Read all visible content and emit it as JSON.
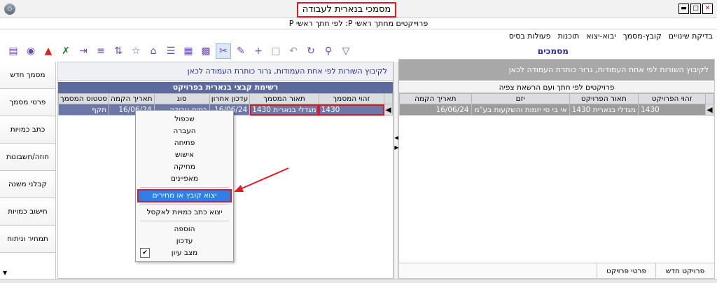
{
  "window": {
    "title": "מסמכי בנארית לעבודה",
    "subtitle": "פרוייקטים מחתך ראשי P: לפי חתך ראשי P"
  },
  "menu": [
    "פעולות בסיס",
    "תוכנות",
    "יבוא-יצוא",
    "קובץ-מסמך",
    "בדיקת שינויים"
  ],
  "section_title": "מסמכים",
  "toolbar_icons": [
    "archive-icon",
    "view-icon",
    "pdf-icon",
    "excel-icon",
    "indent-icon",
    "list-icon",
    "sort-icon",
    "star-icon",
    "bookmark-icon",
    "align-icon",
    "table-icon",
    "qr-icon",
    "cut-icon",
    "edit-icon",
    "plus-icon",
    "save-icon",
    "undo-icon",
    "refresh-icon",
    "search-icon",
    "filter-icon"
  ],
  "left_nav": [
    "מסמך חדש",
    "פרטי מסמך",
    "כתב כמויות",
    "חוזה/חשבונות",
    "קבלני משנה",
    "חישוב כמויות",
    "תמחיר וניתוח"
  ],
  "middle": {
    "grouping_hint": "לקיבוץ השורות לפי אחת העמודות, גרור כותרת העמודה לכאן",
    "grid_title": "רשימת קבצי בנארית בפרויקט",
    "columns": [
      "זהוי המסמך",
      "תאור המסמך",
      "עדכון אחרון",
      "סוג",
      "תאריך הקמה",
      "סטטוס המסמך"
    ],
    "rows": [
      [
        "1430",
        "מגדלי בנארית 1430",
        "16/06/24",
        "בסיס עבודה",
        "16/06/24",
        "תקף"
      ]
    ]
  },
  "right": {
    "grouping_hint": "לקיבוץ השורות לפי אחת העמודות, גרור כותרת העמודה לכאן",
    "grid_title": "פרויקטים לפי חתך ועם הרשאת צפיה",
    "columns": [
      "זהוי הפרויקט",
      "תאור הפרויקט",
      "יזם",
      "תאריך הקמה"
    ],
    "rows": [
      [
        "1430",
        "מגדלי בנארית 1430",
        "אי בי סי יזמות והשקעות בע\"מ",
        "16/06/24"
      ]
    ],
    "tabs": [
      "פרויקט חדש",
      "פרטי פרויקט"
    ]
  },
  "context_menu": {
    "items": [
      "שכפול",
      "העברה",
      "פתיחה",
      "אישוש",
      "מחיקה",
      "מאפיינים"
    ],
    "highlighted": "יצוא קובץ או מחירים",
    "export_excel": "יצוא כתב כמויות לאקסל",
    "items2": [
      "הוספה",
      "עדכון"
    ],
    "view_state": "מצב עיון"
  },
  "colors": {
    "highlight_red": "#e01a22",
    "selected_row": "#6c78a8",
    "menu_active": "#2f7fe6",
    "grid_title_bg": "#5d6a9e"
  }
}
